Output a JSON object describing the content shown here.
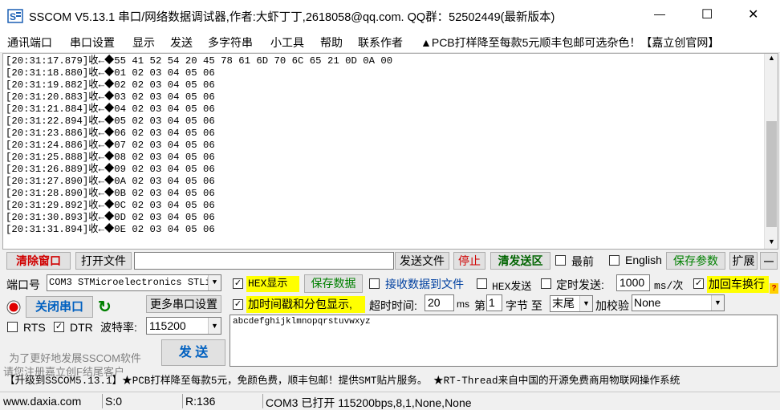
{
  "title": "SSCOM V5.13.1 串口/网络数据调试器,作者:大虾丁丁,2618058@qq.com. QQ群：52502449(最新版本)",
  "window_controls": {
    "minimize": "—",
    "maximize": "☐",
    "close": "✕"
  },
  "menu": [
    "通讯端口",
    "串口设置",
    "显示",
    "发送",
    "多字符串",
    "小工具",
    "帮助",
    "联系作者",
    "▲PCB打样降至每款5元顺丰包邮可选杂色！【嘉立创官网】"
  ],
  "receive_lines": [
    "[20:31:17.879]收←◆55 41 52 54 20 45 78 61 6D 70 6C 65 21 0D 0A 00",
    "[20:31:18.880]收←◆01 02 03 04 05 06",
    "[20:31:19.882]收←◆02 02 03 04 05 06",
    "[20:31:20.883]收←◆03 02 03 04 05 06",
    "[20:31:21.884]收←◆04 02 03 04 05 06",
    "[20:31:22.894]收←◆05 02 03 04 05 06",
    "[20:31:23.886]收←◆06 02 03 04 05 06",
    "[20:31:24.886]收←◆07 02 03 04 05 06",
    "[20:31:25.888]收←◆08 02 03 04 05 06",
    "[20:31:26.889]收←◆09 02 03 04 05 06",
    "[20:31:27.890]收←◆0A 02 03 04 05 06",
    "[20:31:28.890]收←◆0B 02 03 04 05 06",
    "[20:31:29.892]收←◆0C 02 03 04 05 06",
    "[20:31:30.893]收←◆0D 02 03 04 05 06",
    "[20:31:31.894]收←◆0E 02 03 04 05 06"
  ],
  "scroll": {
    "up": "▲",
    "down": "▼"
  },
  "toolbar": {
    "clear": "清除窗口",
    "open_file": "打开文件",
    "file_path": "",
    "send_file": "发送文件",
    "stop": "停止",
    "clear_send": "清发送区",
    "topmost": "最前",
    "english": "English",
    "save_params": "保存参数",
    "expand": "扩展",
    "collapse": "—"
  },
  "port": {
    "label": "端口号",
    "value": "COM3 STMicroelectronics STLi",
    "more_settings": "更多串口设置",
    "close_port": "关闭串口",
    "refresh": "↻",
    "rts": "RTS",
    "dtr": "DTR",
    "baud_label": "波特率:",
    "baud_value": "115200"
  },
  "options": {
    "hex_display": "HEX显示",
    "save_data": "保存数据",
    "recv_to_file": "接收数据到文件",
    "hex_send": "HEX发送",
    "timed_send": "定时发送:",
    "interval": "1000",
    "interval_unit": "ms/次",
    "add_crlf": "加回车换行",
    "timestamp": "加时间戳和分包显示,",
    "timeout_label": "超时时间:",
    "timeout_value": "20",
    "timeout_unit": "ms",
    "byte_prefix": "第",
    "byte_value": "1",
    "byte_mid": "字节 至",
    "byte_end": "末尾",
    "checksum_label": "加校验",
    "checksum_value": "None"
  },
  "send_text": "abcdefghijklmnopqrstuvwxyz",
  "promo": "为了更好地发展SSCOM软件\n请您注册嘉立创F结尾客户",
  "send_button": "发 送",
  "ticker": "【升级到SSCOM5.13.1】★PCB打样降至每款5元，免颜色费，顺丰包邮！提供SMT贴片服务。 ★RT-Thread来自中国的开源免费商用物联网操作系统",
  "status": {
    "site": "www.daxia.com",
    "sent": "S:0",
    "received": "R:136",
    "port_state": "COM3 已打开  115200bps,8,1,None,None"
  }
}
